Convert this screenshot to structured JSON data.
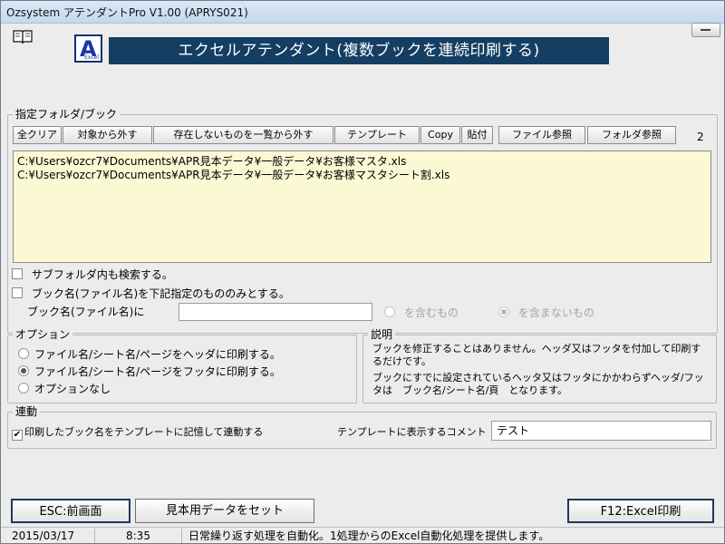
{
  "window": {
    "title": "Ozsystem アテンダントPro V1.00 (APRYS021)"
  },
  "header": {
    "logo_letter": "A",
    "logo_sub": "Excel",
    "banner": "エクセルアテンダント(複数ブックを連続印刷する)"
  },
  "folder_group": {
    "title": "指定フォルダ/ブック",
    "buttons": {
      "clear_all": "全クリア",
      "remove_selected": "対象から外す",
      "remove_missing": "存在しないものを一覧から外す",
      "template": "テンプレート",
      "copy": "Copy",
      "paste": "貼付",
      "file_browse": "ファイル参照",
      "folder_browse": "フォルダ参照"
    },
    "count": "2",
    "files": [
      "C:¥Users¥ozcr7¥Documents¥APR見本データ¥一般データ¥お客様マスタ.xls",
      "C:¥Users¥ozcr7¥Documents¥APR見本データ¥一般データ¥お客様マスタシート割.xls"
    ]
  },
  "filters": {
    "subfolder_label": "サブフォルダ内も検索する。",
    "subfolder_checked": false,
    "bookname_label": "ブック名(ファイル名)を下記指定のもののみとする。",
    "bookname_checked": false,
    "bookname_input_label": "ブック名(ファイル名)に",
    "bookname_input_value": "",
    "include_label": "を含むもの",
    "exclude_label": "を含まないもの",
    "include_selected": false,
    "exclude_selected": true
  },
  "options": {
    "title": "オプション",
    "items": [
      "ファイル名/シート名/ページをヘッダに印刷する。",
      "ファイル名/シート名/ページをフッタに印刷する。",
      "オプションなし"
    ],
    "selected": 1
  },
  "description": {
    "title": "説明",
    "lines": [
      "ブックを修正することはありません。ヘッダ又はフッタを付加して印刷するだけです。",
      "ブックにすでに設定されているヘッタ又はフッタにかかわらずヘッダ/フッタは　ブック名/シート名/頁　となります。"
    ]
  },
  "link": {
    "title": "連動",
    "checked": true,
    "label": "印刷したブック名をテンプレートに記憶して連動する",
    "comment_label": "テンプレートに表示するコメント",
    "comment_value": "テスト"
  },
  "actions": {
    "back": "ESC:前画面",
    "sample": "見本用データをセット",
    "print": "F12:Excel印刷"
  },
  "statusbar": {
    "date": "2015/03/17",
    "time": "8:35",
    "message": "日常繰り返す処理を自動化。1処理からのExcel自動化処理を提供します。"
  },
  "icons": {
    "book": "book-icon",
    "window_control": "restore-icon"
  }
}
